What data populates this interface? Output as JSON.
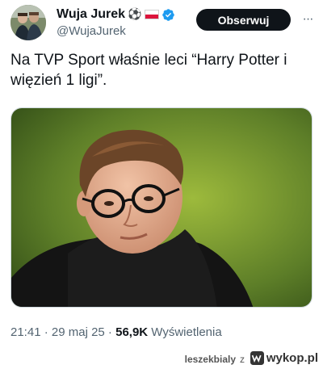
{
  "author": {
    "display_name": "Wuja Jurek",
    "badge_emoji": "⚽",
    "handle": "@WujaJurek",
    "verified_icon": "verified-badge-icon",
    "flag_icon": "poland-flag-icon",
    "brand_color": "#1d9bf0"
  },
  "actions": {
    "follow_label": "Obserwuj",
    "more_label": "···"
  },
  "tweet": {
    "text": "Na TVP Sport właśnie leci “Harry Potter i więzień 1 ligi”."
  },
  "meta": {
    "time": "21:41",
    "sep1": " · ",
    "date": "29 maj 25",
    "sep2": " · ",
    "views_count": "56,9K",
    "views_label": " Wyświetlenia"
  },
  "watermark": {
    "user": "leszekbialy",
    "joiner": "z",
    "site": "wykop.pl"
  }
}
